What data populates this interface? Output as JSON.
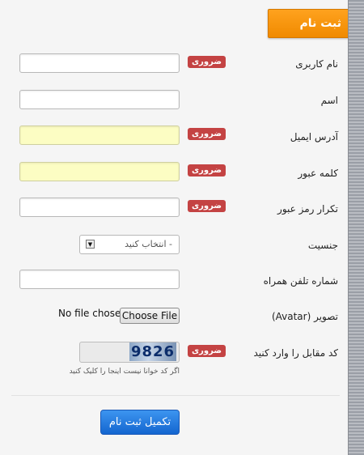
{
  "form": {
    "title": "ثبت نام",
    "required_label": "ضروری",
    "fields": {
      "username": {
        "label": "نام کاربری"
      },
      "name": {
        "label": "اسم"
      },
      "email": {
        "label": "آدرس ایمیل"
      },
      "password": {
        "label": "کلمه عبور"
      },
      "confirm_password": {
        "label": "تکرار رمز عبور"
      },
      "gender": {
        "label": "جنسیت",
        "selected": "- انتخاب کنید"
      },
      "mobile": {
        "label": "شماره تلفن همراه"
      },
      "avatar": {
        "label": "تصویر (Avatar)",
        "button": "Choose File",
        "status": "No file chosen"
      },
      "captcha": {
        "label": "کد مقابل را وارد کنید",
        "image_text": "9826",
        "hint": "اگر کد خوانا نیست اینجا را کلیک کنید"
      }
    },
    "submit_label": "تکمیل ثبت نام"
  },
  "colors": {
    "tab": "#f39200",
    "required_badge": "#c44343",
    "highlight_input": "#fcfdc3",
    "submit_button": "#1f76de"
  }
}
